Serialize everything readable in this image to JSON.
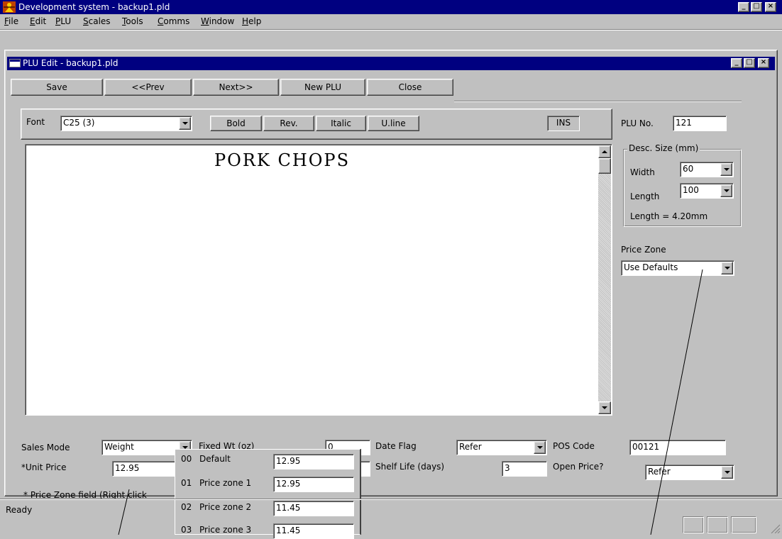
{
  "app": {
    "title": "Development system - backup1.pld",
    "menu": [
      {
        "label": "File",
        "key": "F",
        "rest": "ile"
      },
      {
        "label": "Edit",
        "key": "E",
        "rest": "dit"
      },
      {
        "label": "PLU",
        "key": "P",
        "rest": "LU"
      },
      {
        "label": "Scales",
        "key": "S",
        "rest": "cales"
      },
      {
        "label": "Tools",
        "key": "T",
        "rest": "ools"
      },
      {
        "label": "Comms",
        "key": "C",
        "rest": "omms"
      },
      {
        "label": "Window",
        "key": "W",
        "rest": "indow"
      },
      {
        "label": "Help",
        "key": "H",
        "rest": "elp"
      }
    ],
    "window_buttons": {
      "minimize": "_",
      "maximize": "□",
      "close": "×"
    }
  },
  "child": {
    "title": "PLU Edit - backup1.pld",
    "toolbar": {
      "save": "Save",
      "prev": "<<Prev",
      "next": "Next>>",
      "new_plu": "New PLU",
      "close": "Close"
    }
  },
  "format": {
    "font_label": "Font",
    "font_value": "C25 (3)",
    "bold": "Bold",
    "rev": "Rev.",
    "italic": "Italic",
    "uline": "U.line",
    "ins": "INS"
  },
  "editor": {
    "text": "PORK  CHOPS"
  },
  "right_panel": {
    "plu_no_label": "PLU No.",
    "plu_no": "121",
    "desc_size_label": "Desc. Size (mm)",
    "width_label": "Width",
    "width_value": "60",
    "length_label": "Length",
    "length_value": "100",
    "length_calc": "Length = 4.20mm",
    "price_zone_label": "Price Zone",
    "price_zone_value": "Use Defaults"
  },
  "fields": {
    "sales_mode_label": "Sales Mode",
    "sales_mode_value": "Weight",
    "unit_price_label": "*Unit Price",
    "unit_price_value": "12.95",
    "fixed_wt_label": "Fixed Wt (oz)",
    "fixed_wt_value": "0",
    "date_flag_label": "Date Flag",
    "date_flag_value": "Refer",
    "shelf_life_label": "Shelf Life (days)",
    "shelf_life_value": "3",
    "pos_code_label": "POS Code",
    "pos_code_value": "00121",
    "open_price_label": "Open Price?",
    "open_price_value": "Refer",
    "footnote": "* Price Zone field (Right click"
  },
  "price_zones": [
    {
      "num": "00",
      "name": "Default",
      "value": "12.95"
    },
    {
      "num": "01",
      "name": "Price zone 1",
      "value": "12.95"
    },
    {
      "num": "02",
      "name": "Price zone 2",
      "value": "11.45"
    },
    {
      "num": "03",
      "name": "Price zone 3",
      "value": "11.45"
    }
  ],
  "status": {
    "text": "Ready"
  }
}
